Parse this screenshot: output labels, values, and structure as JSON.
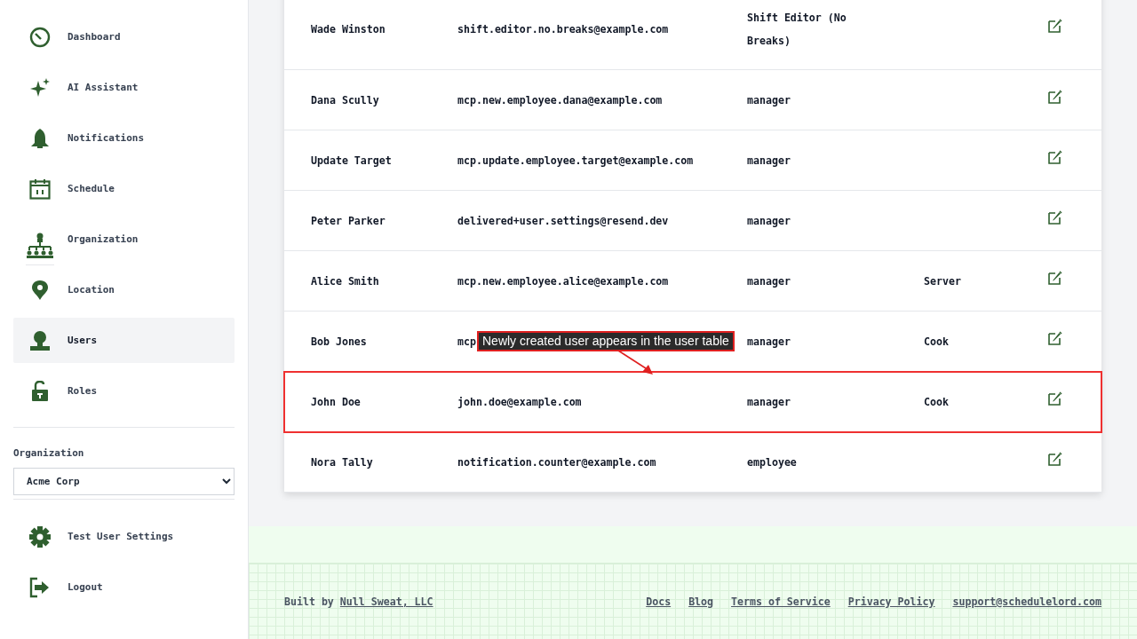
{
  "sidebar": {
    "nav_items": [
      {
        "label": "Dashboard",
        "kind": "gauge",
        "selected": false
      },
      {
        "label": "AI Assistant",
        "kind": "sparkle",
        "selected": false
      },
      {
        "label": "Notifications",
        "kind": "bell",
        "selected": false
      },
      {
        "label": "Schedule",
        "kind": "calendar",
        "selected": false
      },
      {
        "label": "Organization",
        "kind": "org",
        "selected": false
      },
      {
        "label": "Location",
        "kind": "pin",
        "selected": false
      },
      {
        "label": "Users",
        "kind": "user",
        "selected": true
      },
      {
        "label": "Roles",
        "kind": "lock",
        "selected": false
      }
    ],
    "organization_label": "Organization",
    "organization_select": "Acme Corp",
    "bottom_items": [
      {
        "label": "Test User Settings",
        "kind": "gear"
      },
      {
        "label": "Logout",
        "kind": "logout"
      }
    ]
  },
  "users_table": {
    "rows": [
      {
        "name": "Wade Winston",
        "email": "shift.editor.no.breaks@example.com",
        "role": "Shift Editor (No Breaks)",
        "highlighted": false
      },
      {
        "name": "Dana Scully",
        "email": "mcp.new.employee.dana@example.com",
        "role": "manager",
        "highlighted": false
      },
      {
        "name": "Update Target",
        "email": "mcp.update.employee.target@example.com",
        "role": "manager",
        "highlighted": false
      },
      {
        "name": "Peter Parker",
        "email": "delivered+user.settings@resend.dev",
        "role": "manager",
        "highlighted": false
      },
      {
        "name": "Alice Smith",
        "email": "mcp.new.employee.alice@example.com",
        "role": "manager",
        "position": "Server",
        "highlighted": false
      },
      {
        "name": "Bob Jones",
        "email": "mcp",
        "role": "manager",
        "position": "Cook",
        "highlighted": false
      },
      {
        "name": "John Doe",
        "email": "john.doe@example.com",
        "role": "manager",
        "position": "Cook",
        "highlighted": true
      },
      {
        "name": "Nora Tally",
        "email": "notification.counter@example.com",
        "role": "employee",
        "highlighted": false
      }
    ]
  },
  "annotation": {
    "text": "Newly created user appears in the user table"
  },
  "footer": {
    "built_by": "Built by",
    "company_link": "Null Sweat, LLC",
    "links": [
      "Docs",
      "Blog",
      "Terms of Service",
      "Privacy Policy",
      "support@schedulelord.com"
    ]
  }
}
